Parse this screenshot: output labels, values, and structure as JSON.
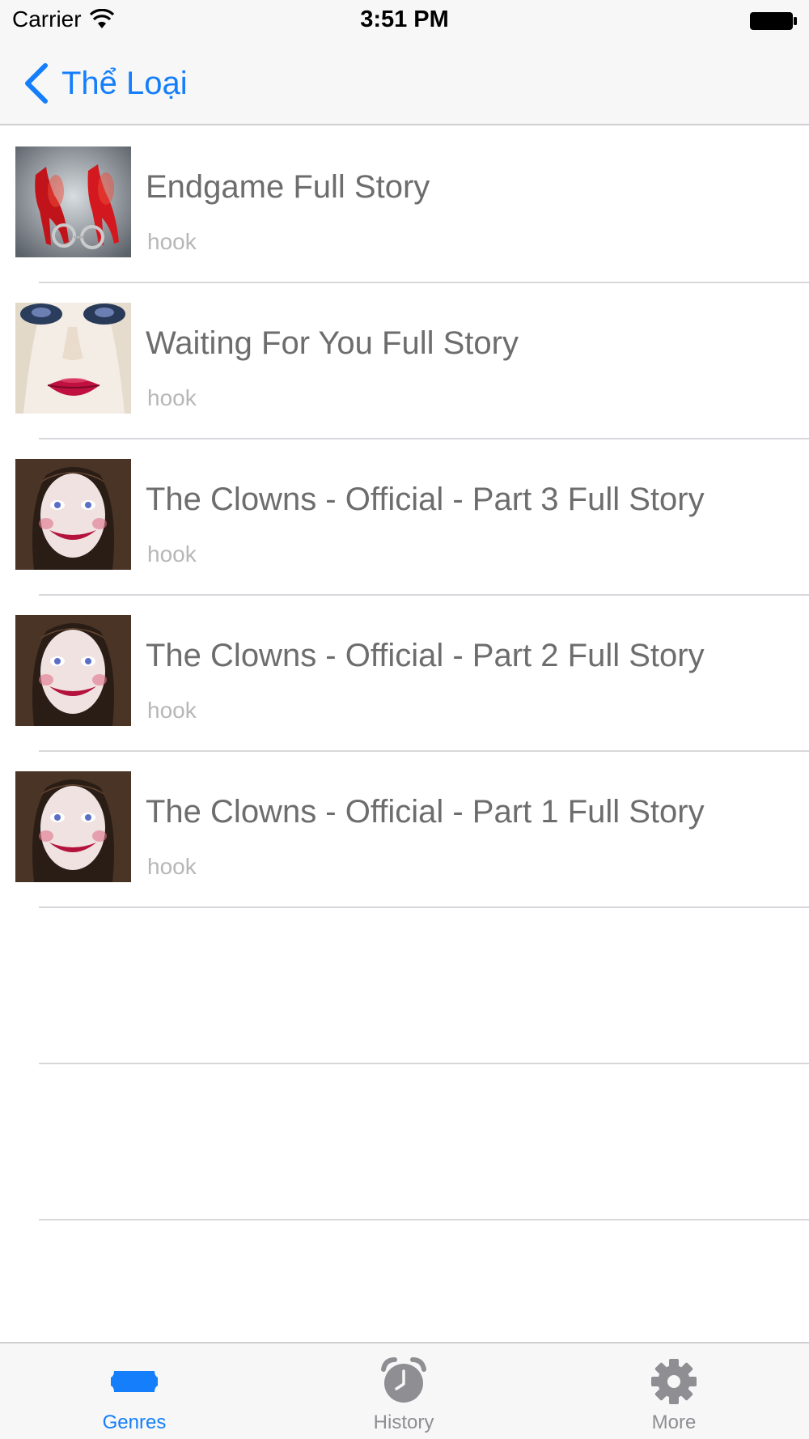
{
  "status_bar": {
    "carrier": "Carrier",
    "time": "3:51 PM"
  },
  "nav": {
    "back_label": "Thể Loại"
  },
  "stories": [
    {
      "title": "Endgame Full Story",
      "subtitle": "hook",
      "thumb": "red-heels-handcuffs"
    },
    {
      "title": "Waiting For You Full Story",
      "subtitle": "hook",
      "thumb": "face-red-lips"
    },
    {
      "title": "The Clowns - Official - Part 3 Full Story",
      "subtitle": "hook",
      "thumb": "clown-girl"
    },
    {
      "title": "The Clowns - Official - Part 2 Full Story",
      "subtitle": "hook",
      "thumb": "clown-girl"
    },
    {
      "title": "The Clowns - Official - Part 1 Full Story",
      "subtitle": "hook",
      "thumb": "clown-girl"
    }
  ],
  "tabs": [
    {
      "label": "Genres",
      "icon": "ticket-icon",
      "active": true
    },
    {
      "label": "History",
      "icon": "alarm-clock-icon",
      "active": false
    },
    {
      "label": "More",
      "icon": "gear-icon",
      "active": false
    }
  ],
  "colors": {
    "accent": "#147efb",
    "inactive": "#8e8e93",
    "title_text": "#6d6d6d",
    "subtitle_text": "#b7b7b7"
  }
}
